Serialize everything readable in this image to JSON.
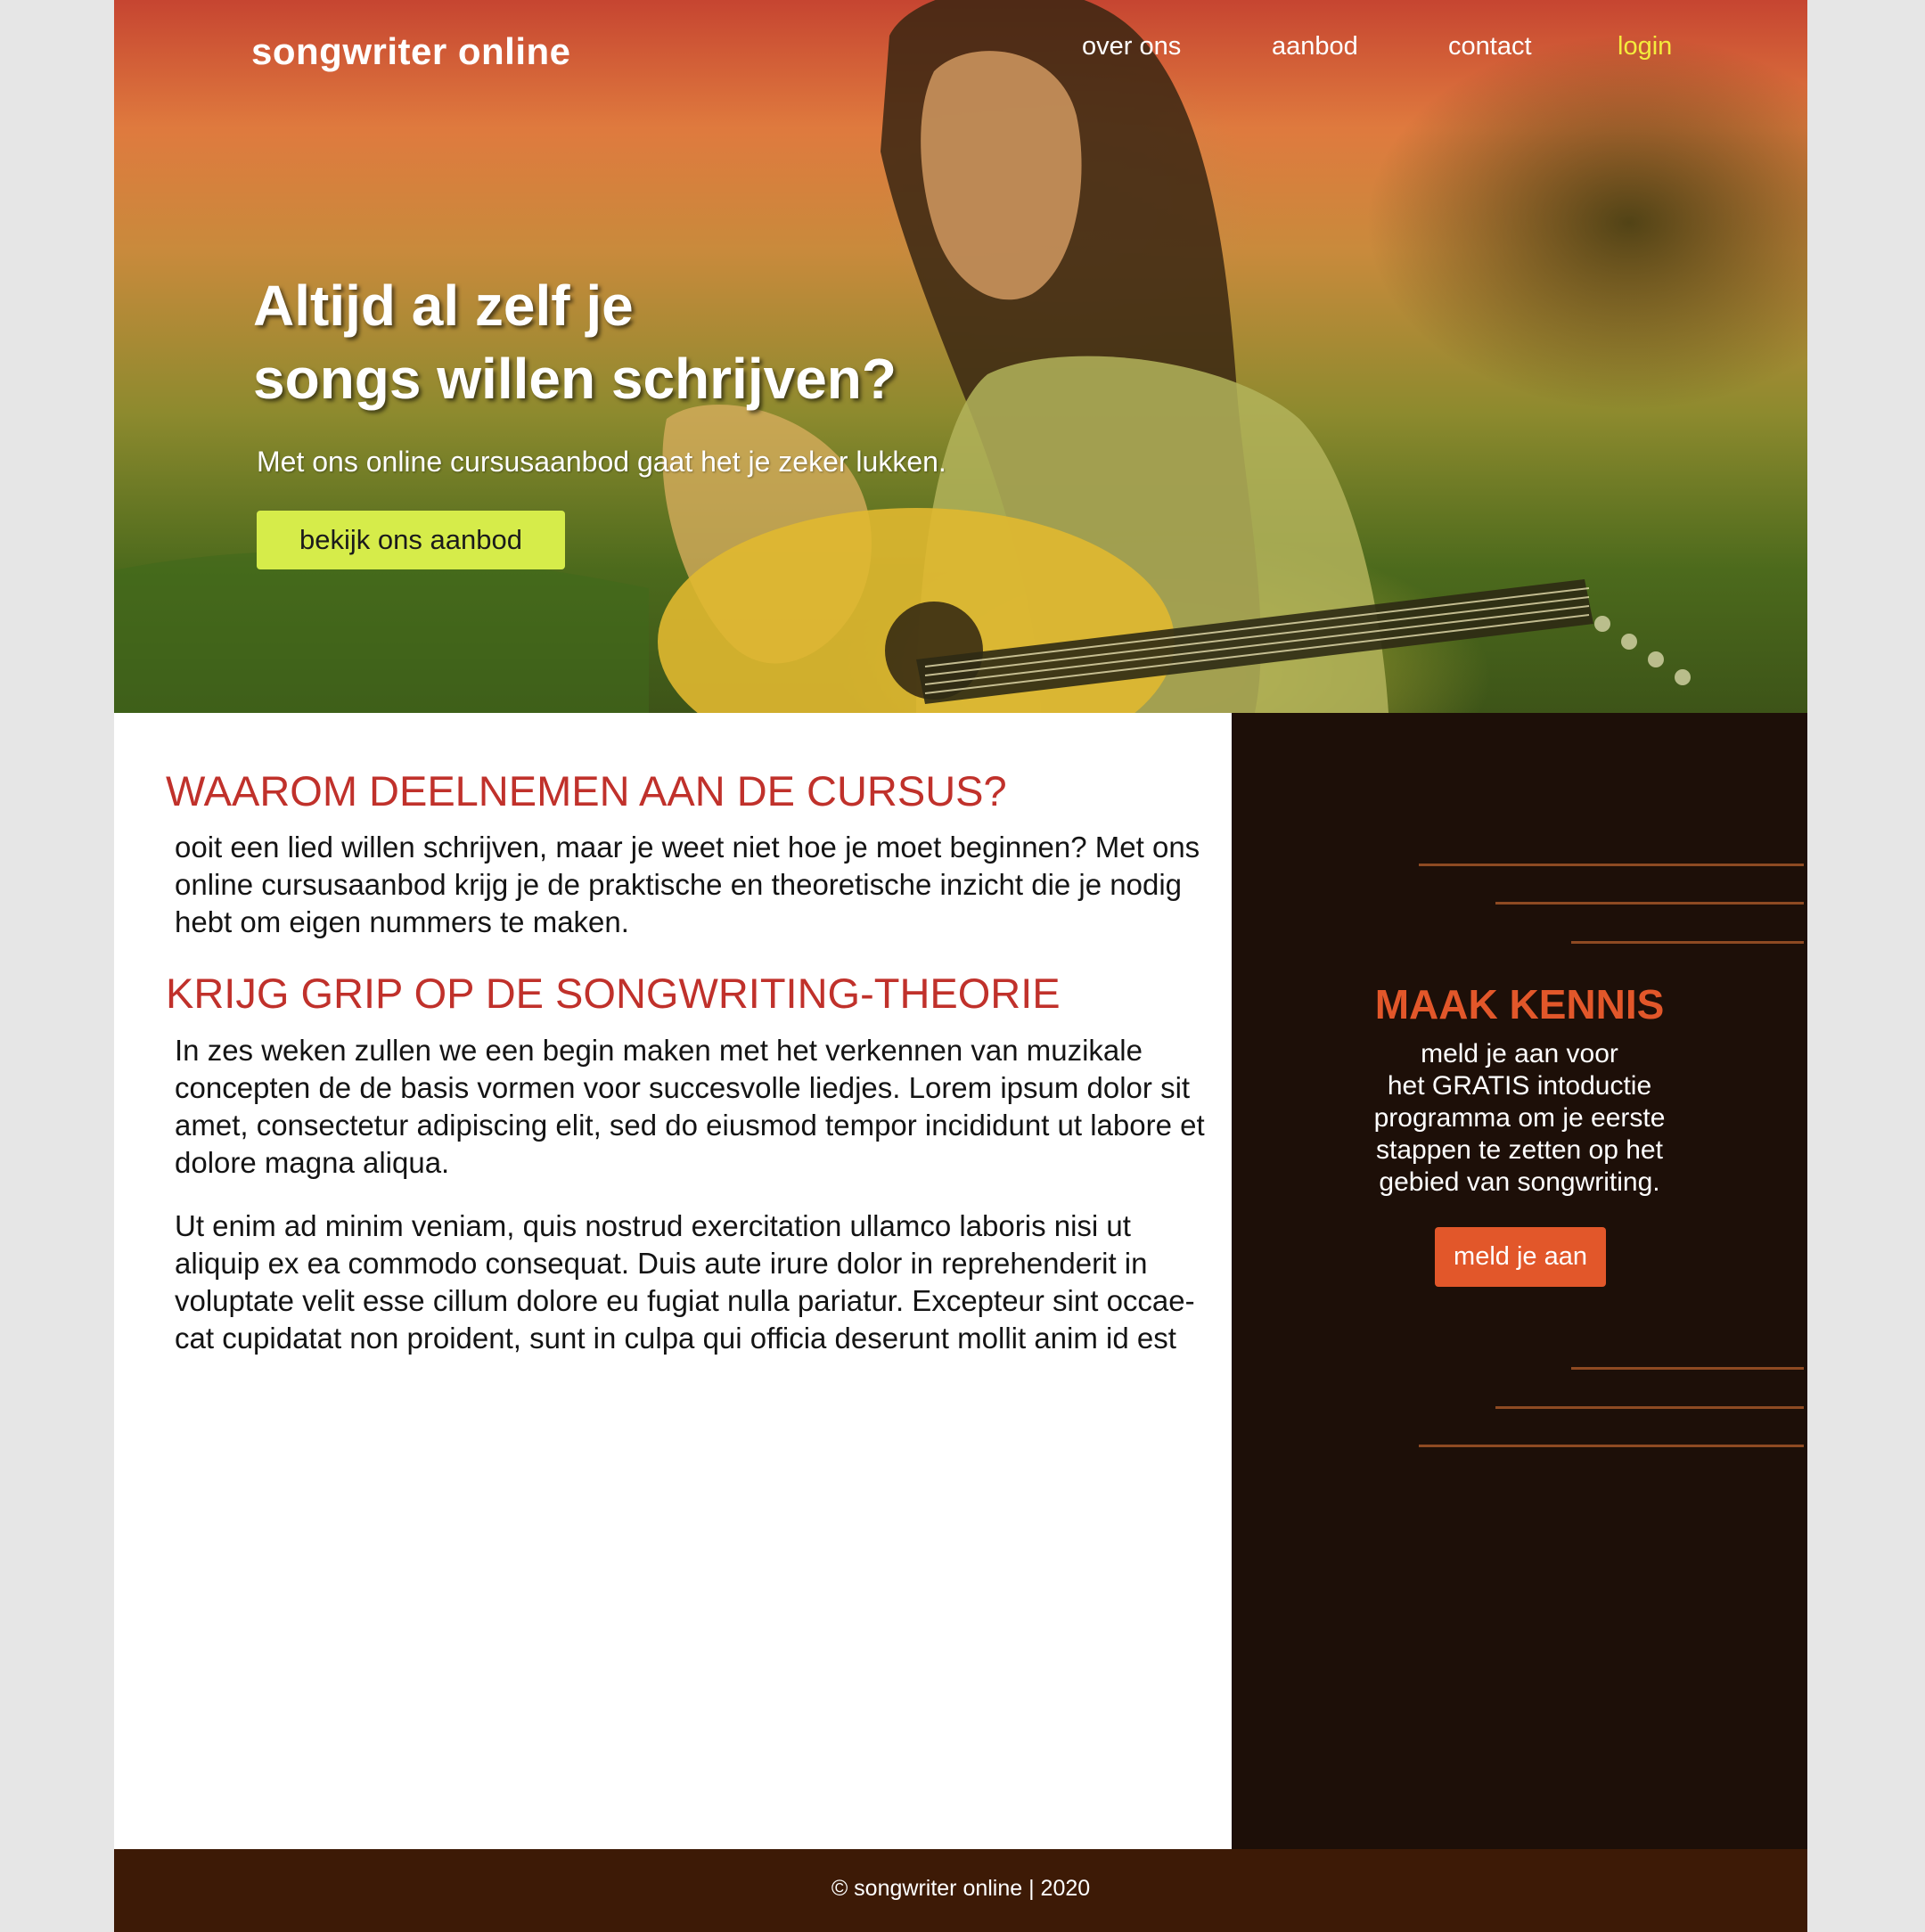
{
  "header": {
    "brand": "songwriter online",
    "nav": [
      {
        "label": "over ons"
      },
      {
        "label": "aanbod"
      },
      {
        "label": "contact"
      },
      {
        "label": "login"
      }
    ]
  },
  "hero": {
    "title_line1": "Altijd al zelf je",
    "title_line2": "songs willen schrijven?",
    "subtitle": "Met ons online cursusaanbod gaat het je zeker lukken.",
    "cta_label": "bekijk ons aanbod"
  },
  "main": {
    "heading1": "WAAROM DEELNEMEN AAN DE CURSUS?",
    "paragraph1": "ooit een lied willen schrijven, maar je weet niet hoe je moet beginnen? Met ons online cursusaanbod krijg je de praktische en theoretische inzicht die je nodig hebt om eigen nummers te maken.",
    "heading2": "KRIJG GRIP OP DE SONGWRITING-THEORIE",
    "paragraph2": "In zes weken zullen we een begin maken met het verkennen van muzikale concepten de de basis vormen voor succesvolle liedjes. Lorem ipsum dolor sit amet, consectetur adipiscing elit, sed do eiusmod tempor incididunt ut labore et dolore magna aliqua.",
    "paragraph3": "Ut enim ad minim veniam, quis nostrud exercitation ullamco laboris nisi ut aliquip ex ea commodo consequat. Duis aute irure dolor in reprehenderit in voluptate velit esse cillum dolore eu fugiat nulla pariatur. Excepteur sint occae- cat cupidatat non proident, sunt in culpa qui officia deserunt mollit anim id est"
  },
  "sidebar": {
    "heading": "MAAK KENNIS",
    "text_lines": [
      "meld je aan voor",
      "het GRATIS intoductie",
      "programma om je eerste",
      "stappen te zetten op het",
      "gebied van songwriting."
    ],
    "cta_label": "meld je aan"
  },
  "footer": {
    "text": "© songwriter online | 2020"
  },
  "colors": {
    "accent_red": "#c0312b",
    "accent_orange": "#e2572a",
    "cta_yellow": "#d6ec4a",
    "login_yellow": "#f4ec3c",
    "sidebar_bg": "#1d0f08",
    "footer_bg": "#3d1a06"
  }
}
